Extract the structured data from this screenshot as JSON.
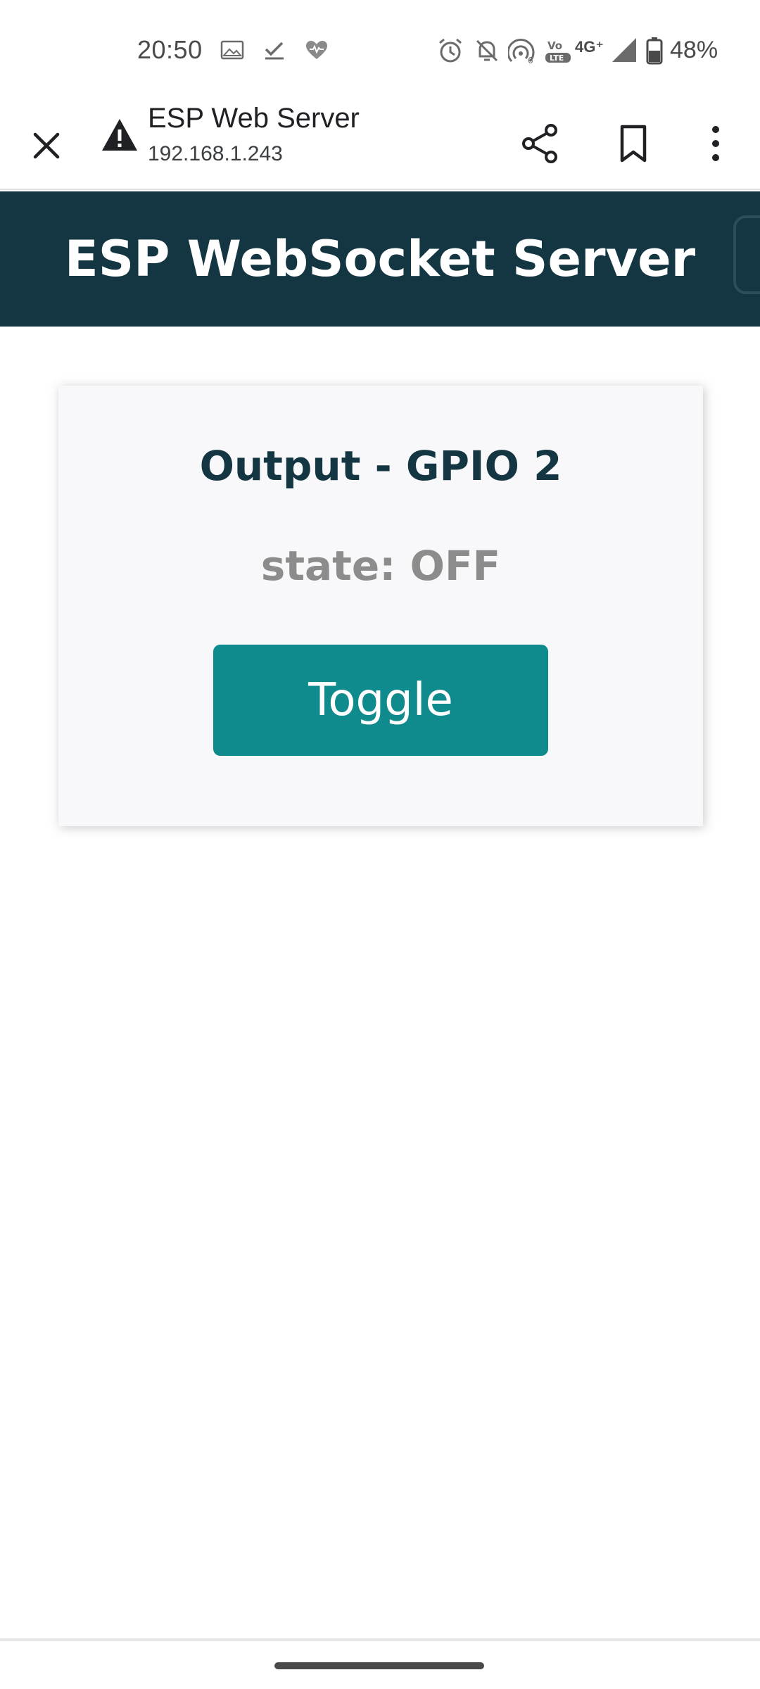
{
  "status_bar": {
    "time": "20:50",
    "network": "4G⁺",
    "battery": "48%",
    "left_icons": [
      "image-icon",
      "check-icon",
      "heart-icon"
    ],
    "right_icons": [
      "alarm-icon",
      "mute-icon",
      "hotspot-icon",
      "volte-icon",
      "signal-icon",
      "battery-icon"
    ]
  },
  "browser": {
    "page_title": "ESP Web Server",
    "url": "192.168.1.243",
    "icons": [
      "close-icon",
      "warning-icon",
      "share-icon",
      "bookmark-icon",
      "more-vert-icon"
    ]
  },
  "page": {
    "header_title": "ESP WebSocket Server",
    "card": {
      "title": "Output - GPIO 2",
      "state": "state: OFF",
      "button_label": "Toggle"
    }
  },
  "colors": {
    "header_bg": "#143642",
    "card_bg": "#f8f7f9",
    "button_bg": "#0f8b8d",
    "title_text": "#143642",
    "state_text": "#8c8c8c"
  }
}
